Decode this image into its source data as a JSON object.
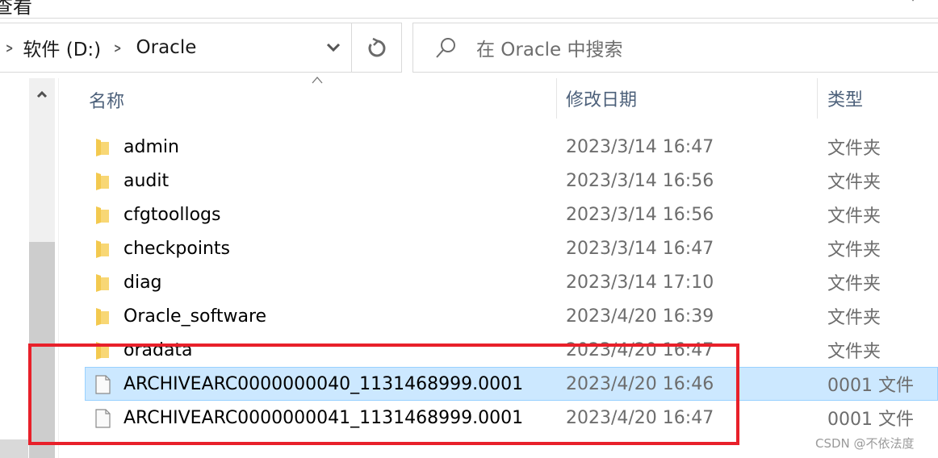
{
  "ribbon": {
    "tab_label": "查看"
  },
  "address_bar": {
    "crumbs": [
      "软件 (D:)",
      "Oracle"
    ],
    "dropdown_icon": "chevron-down-icon",
    "refresh_icon": "refresh-icon"
  },
  "search": {
    "placeholder": "在 Oracle 中搜索",
    "icon": "search-icon"
  },
  "columns": {
    "name": "名称",
    "date": "修改日期",
    "type": "类型",
    "sorted_by": "name",
    "sort_direction": "ascending"
  },
  "files": [
    {
      "name": "admin",
      "date": "2023/3/14 16:47",
      "type": "文件夹",
      "kind": "folder",
      "selected": false
    },
    {
      "name": "audit",
      "date": "2023/3/14 16:56",
      "type": "文件夹",
      "kind": "folder",
      "selected": false
    },
    {
      "name": "cfgtoollogs",
      "date": "2023/3/14 16:56",
      "type": "文件夹",
      "kind": "folder",
      "selected": false
    },
    {
      "name": "checkpoints",
      "date": "2023/3/14 16:47",
      "type": "文件夹",
      "kind": "folder",
      "selected": false
    },
    {
      "name": "diag",
      "date": "2023/3/14 17:10",
      "type": "文件夹",
      "kind": "folder",
      "selected": false
    },
    {
      "name": "Oracle_software",
      "date": "2023/4/20 16:39",
      "type": "文件夹",
      "kind": "folder",
      "selected": false
    },
    {
      "name": "oradata",
      "date": "2023/4/20 16:47",
      "type": "文件夹",
      "kind": "folder",
      "selected": false
    },
    {
      "name": "ARCHIVEARC0000000040_1131468999.0001",
      "date": "2023/4/20 16:46",
      "type": "0001 文件",
      "kind": "file",
      "selected": true
    },
    {
      "name": "ARCHIVEARC0000000041_1131468999.0001",
      "date": "2023/4/20 16:47",
      "type": "0001 文件",
      "kind": "file",
      "selected": false
    }
  ],
  "annotation": {
    "color": "#e8202a",
    "description": "red highlight box around archive files"
  },
  "colors": {
    "selection_bg": "#cce8ff",
    "selection_border": "#99d1ff",
    "header_text": "#4c607a",
    "secondary_text": "#6d6d6d"
  },
  "watermark": "CSDN @不依法度"
}
